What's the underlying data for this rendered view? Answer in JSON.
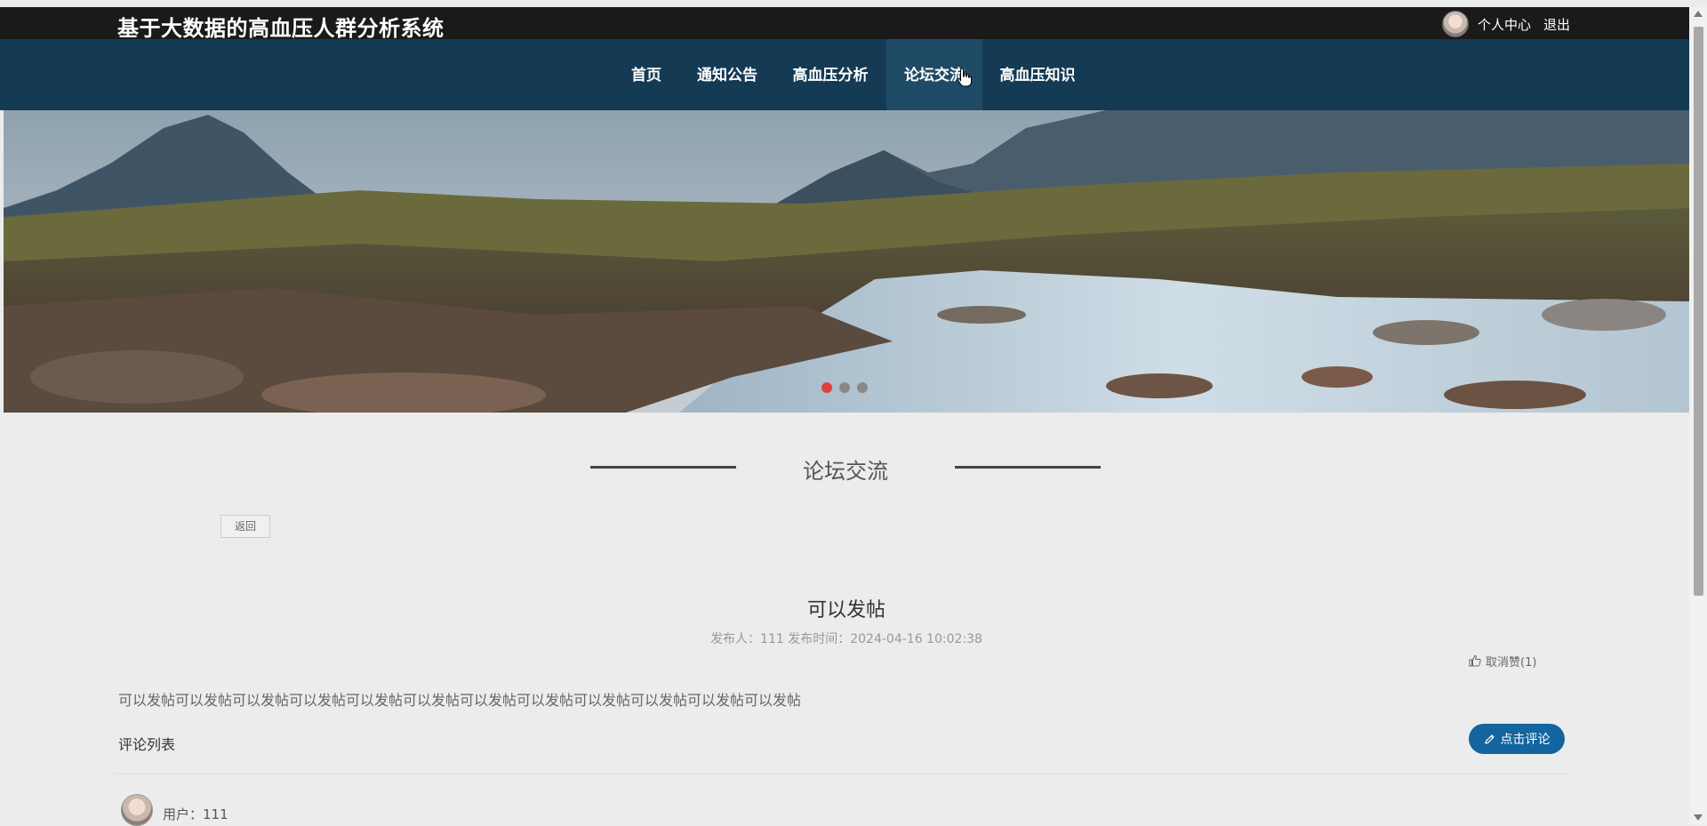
{
  "header": {
    "site_title": "基于大数据的高血压人群分析系统",
    "user_center": "个人中心",
    "logout": "退出"
  },
  "nav": {
    "items": [
      {
        "label": "首页"
      },
      {
        "label": "通知公告"
      },
      {
        "label": "高血压分析"
      },
      {
        "label": "论坛交流",
        "active": true
      },
      {
        "label": "高血压知识"
      }
    ]
  },
  "carousel": {
    "slide_count": 3,
    "active_index": 0
  },
  "section": {
    "title": "论坛交流"
  },
  "back_button": "返回",
  "post": {
    "title": "可以发帖",
    "meta": "发布人：111   发布时间：2024-04-16 10:02:38",
    "like_label": "取消赞(1)",
    "content": "可以发帖可以发帖可以发帖可以发帖可以发帖可以发帖可以发帖可以发帖可以发帖可以发帖可以发帖可以发帖"
  },
  "comments": {
    "list_label": "评论列表",
    "add_button": "点击评论",
    "items": [
      {
        "user": "用户：111"
      }
    ]
  },
  "colors": {
    "topbar": "#1a1a1a",
    "navbar": "#143a54",
    "accent_button": "#12659e",
    "active_dot": "#e0413a"
  }
}
